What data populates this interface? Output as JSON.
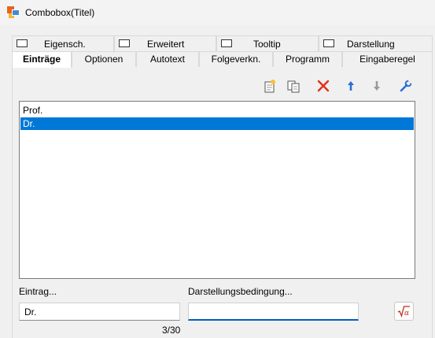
{
  "window": {
    "title": "Combobox(Titel)"
  },
  "tabs_row1": [
    {
      "label": "Eigensch."
    },
    {
      "label": "Erweitert"
    },
    {
      "label": "Tooltip"
    },
    {
      "label": "Darstellung"
    }
  ],
  "tabs_row2": [
    {
      "label": "Einträge",
      "active": true
    },
    {
      "label": "Optionen"
    },
    {
      "label": "Autotext"
    },
    {
      "label": "Folgeverkn."
    },
    {
      "label": "Programm"
    },
    {
      "label": "Eingaberegel"
    }
  ],
  "toolbar": {
    "icons": [
      "new-entry-icon",
      "copy-icon",
      "delete-icon",
      "move-up-icon",
      "move-down-icon",
      "tools-icon"
    ],
    "colors": {
      "delete": "#e0301e",
      "arrow_up": "#2c6fd1",
      "arrow_down": "#9a9a9a",
      "tools": "#2c6fd1"
    }
  },
  "list": {
    "items": [
      "Prof.",
      "Dr."
    ],
    "selected_index": 1,
    "selection_color": "#0078d7"
  },
  "form": {
    "entry_label": "Eintrag...",
    "entry_value": "Dr.",
    "condition_label": "Darstellungsbedingung...",
    "condition_value": "",
    "counter": "3/30",
    "formula_button_icon": "sqrt-alpha-icon"
  }
}
